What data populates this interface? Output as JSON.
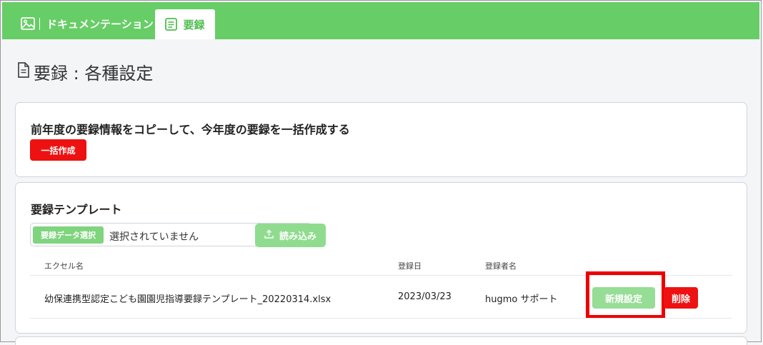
{
  "tabs": [
    {
      "label": "ドキュメンテーション",
      "icon": "image-icon",
      "active": false
    },
    {
      "label": "要録",
      "icon": "notes-icon",
      "active": true
    }
  ],
  "page_title": "要録 : 各種設定",
  "bulk_card": {
    "heading": "前年度の要録情報をコピーして、今年度の要録を一括作成する",
    "button_label": "一括作成"
  },
  "template_card": {
    "heading": "要録テンプレート",
    "file_choose_label": "要録データ選択",
    "file_status": "選択されていません",
    "upload_label": "読み込み",
    "columns": [
      "エクセル名",
      "登録日",
      "登録者名"
    ],
    "rows": [
      {
        "excel_name": "幼保連携型認定こども園園児指導要録テンプレート_20220314.xlsx",
        "date": "2023/03/23",
        "registrant": "hugmo サポート",
        "new_label": "新規設定",
        "delete_label": "削除"
      }
    ]
  },
  "colors": {
    "brand_green": "#67cd66",
    "danger_red": "#ee1111",
    "highlight_red": "#ee0000"
  }
}
